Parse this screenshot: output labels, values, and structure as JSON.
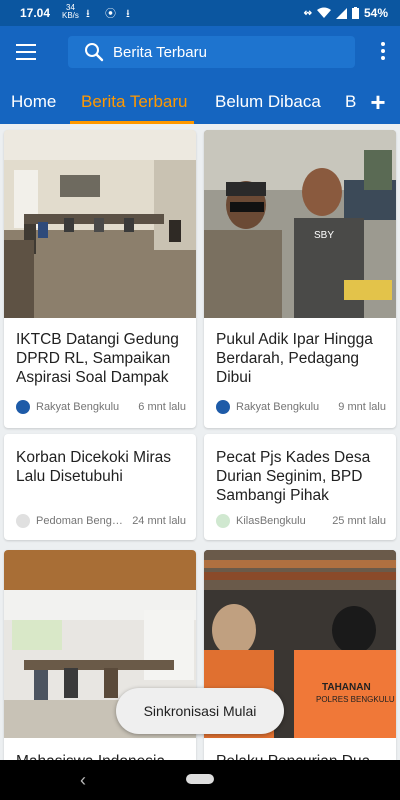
{
  "status_bar": {
    "time": "17.04",
    "net_speed": "34",
    "net_unit": "KB/s",
    "battery": "54%"
  },
  "app_bar": {
    "search_placeholder": "Berita Terbaru"
  },
  "tabs": [
    {
      "label": "Home",
      "active": false
    },
    {
      "label": "Berita Terbaru",
      "active": true
    },
    {
      "label": "Belum Dibaca",
      "active": false
    },
    {
      "label": "B",
      "active": false
    }
  ],
  "articles": [
    {
      "title": "IKTCB Datangi Gedung DPRD RL, Sampaikan Aspirasi  Soal Dampak",
      "source": "Rakyat Bengkulu",
      "time": "6 mnt lalu",
      "image": "meeting-room"
    },
    {
      "title": "Pukul Adik Ipar Hingga Berdarah, Pedagang Dibui",
      "source": "Rakyat Bengkulu",
      "time": "9 mnt lalu",
      "image": "police-office"
    },
    {
      "title": "Korban Dicekoki Miras Lalu Disetubuhi",
      "source": "Pedoman Bengkulu",
      "time": "24 mnt lalu"
    },
    {
      "title": "Pecat Pjs Kades Desa Durian Seginim, BPD Sambangi Pihak",
      "source": "KilasBengkulu",
      "time": "25 mnt lalu"
    },
    {
      "title": "Mahasiswa Indonesia",
      "source": "",
      "time": "",
      "image": "hall"
    },
    {
      "title": "Pelaku Pencurian Dua",
      "source": "",
      "time": "",
      "image": "prisoners"
    }
  ],
  "image_texts": {
    "shirt": "SBY",
    "vest_line1": "TAHANAN",
    "vest_line2": "POLRES BENGKULU"
  },
  "toast": "Sinkronisasi Mulai",
  "colors": {
    "primary": "#1565C0",
    "status_bar": "#0B56A0",
    "accent": "#FF9800",
    "background": "#ECEFF1"
  }
}
